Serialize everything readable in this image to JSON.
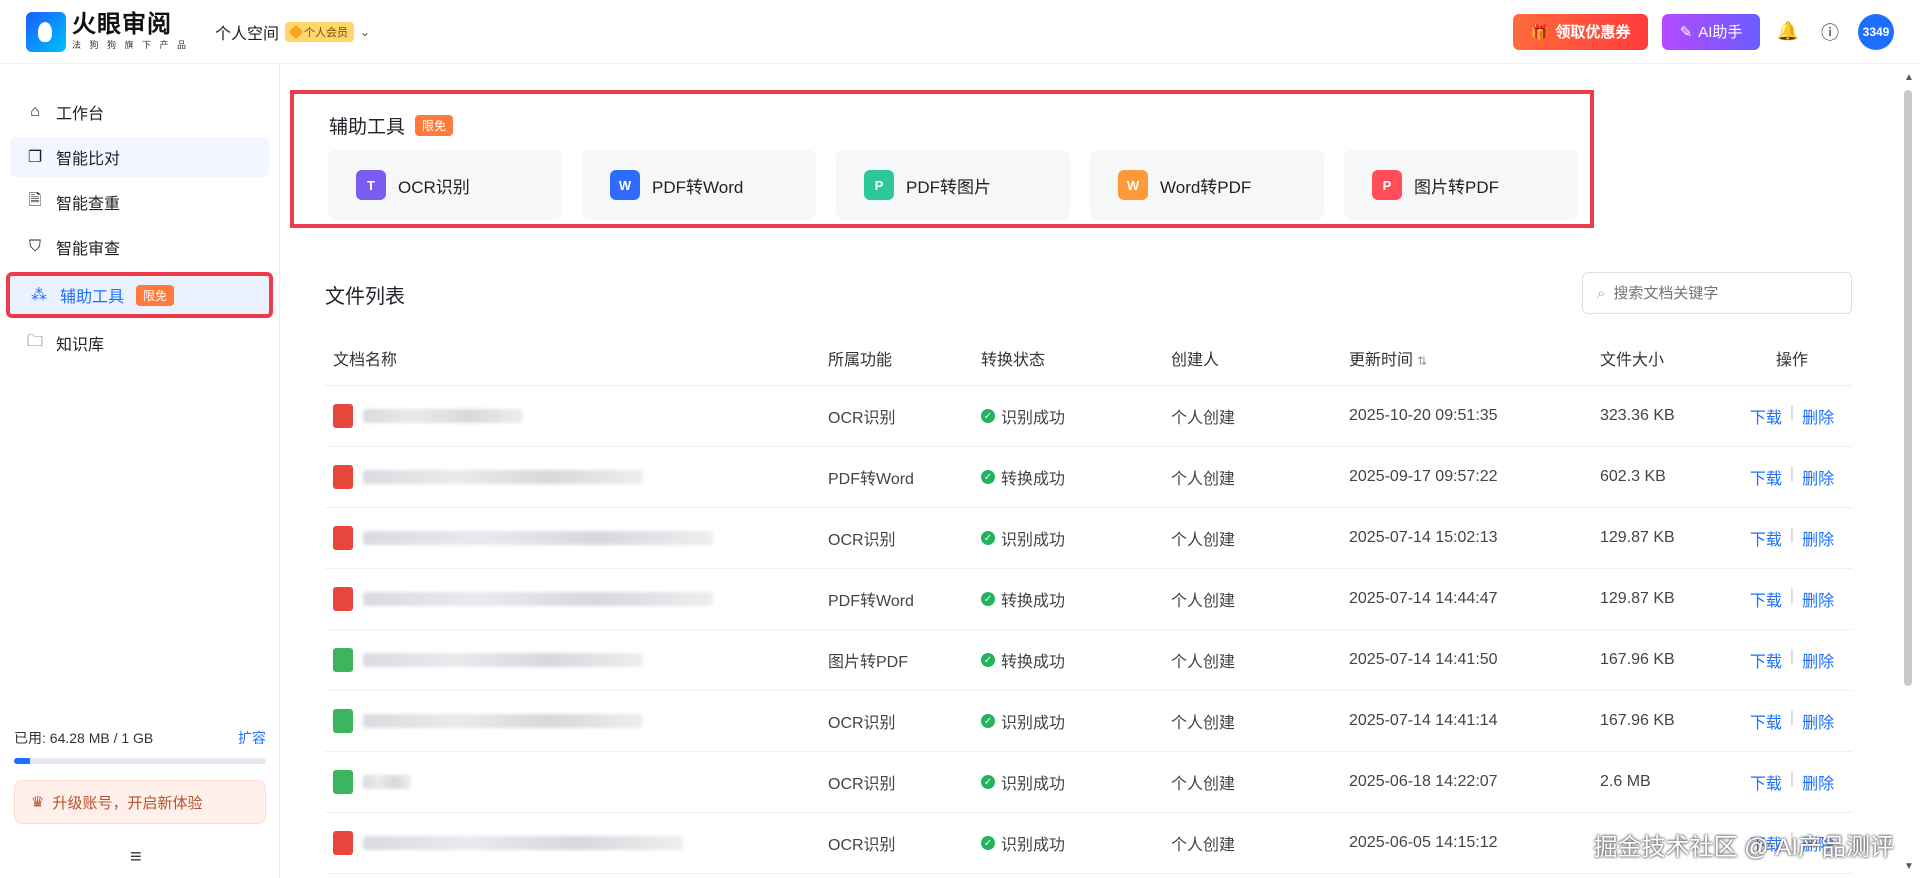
{
  "header": {
    "logo_title": "火眼审阅",
    "logo_sub": "法 狗 狗 旗 下 产 品",
    "space_label": "个人空间",
    "vip_label": "个人会员",
    "coupon_label": "领取优惠券",
    "ai_label": "AI助手",
    "user_id": "3349"
  },
  "sidebar": {
    "items": [
      {
        "label": "工作台",
        "icon": "home-icon"
      },
      {
        "label": "智能比对",
        "icon": "compare-icon"
      },
      {
        "label": "智能查重",
        "icon": "duplicate-icon"
      },
      {
        "label": "智能审查",
        "icon": "shield-icon"
      },
      {
        "label": "辅助工具",
        "icon": "tools-icon",
        "tag": "限免"
      },
      {
        "label": "知识库",
        "icon": "folder-icon"
      }
    ],
    "storage_label": "已用: 64.28 MB / 1 GB",
    "storage_fraction": 0.063,
    "expand_label": "扩容",
    "upgrade_label": "升级账号，开启新体验"
  },
  "tools": {
    "title": "辅助工具",
    "tag": "限免",
    "cards": [
      {
        "label": "OCR识别",
        "color": "#7a5cf0",
        "glyph": "T"
      },
      {
        "label": "PDF转Word",
        "color": "#2f6bff",
        "glyph": "W"
      },
      {
        "label": "PDF转图片",
        "color": "#2cc79a",
        "glyph": "P"
      },
      {
        "label": "Word转PDF",
        "color": "#ff9a3a",
        "glyph": "W"
      },
      {
        "label": "图片转PDF",
        "color": "#ff4d5a",
        "glyph": "P"
      }
    ]
  },
  "files": {
    "title": "文件列表",
    "search_placeholder": "搜索文档关键字",
    "columns": [
      "文档名称",
      "所属功能",
      "转换状态",
      "创建人",
      "更新时间",
      "文件大小",
      "操作"
    ],
    "download_label": "下载",
    "delete_label": "删除",
    "rows": [
      {
        "func": "OCR识别",
        "status": "识别成功",
        "creator": "个人创建",
        "time": "2025-10-20 09:51:35",
        "size": "323.36 KB",
        "icon_color": "#e8453c"
      },
      {
        "func": "PDF转Word",
        "status": "转换成功",
        "creator": "个人创建",
        "time": "2025-09-17 09:57:22",
        "size": "602.3 KB",
        "icon_color": "#e8453c"
      },
      {
        "func": "OCR识别",
        "status": "识别成功",
        "creator": "个人创建",
        "time": "2025-07-14 15:02:13",
        "size": "129.87 KB",
        "icon_color": "#e8453c"
      },
      {
        "func": "PDF转Word",
        "status": "转换成功",
        "creator": "个人创建",
        "time": "2025-07-14 14:44:47",
        "size": "129.87 KB",
        "icon_color": "#e8453c"
      },
      {
        "func": "图片转PDF",
        "status": "转换成功",
        "creator": "个人创建",
        "time": "2025-07-14 14:41:50",
        "size": "167.96 KB",
        "icon_color": "#3cb55e"
      },
      {
        "func": "OCR识别",
        "status": "识别成功",
        "creator": "个人创建",
        "time": "2025-07-14 14:41:14",
        "size": "167.96 KB",
        "icon_color": "#3cb55e"
      },
      {
        "func": "OCR识别",
        "status": "识别成功",
        "creator": "个人创建",
        "time": "2025-06-18 14:22:07",
        "size": "2.6 MB",
        "icon_color": "#3cb55e"
      },
      {
        "func": "OCR识别",
        "status": "识别成功",
        "creator": "个人创建",
        "time": "2025-06-05 14:15:12",
        "size": "",
        "icon_color": "#e8453c"
      }
    ]
  },
  "watermark": "掘金技术社区 @ AI产品测评"
}
